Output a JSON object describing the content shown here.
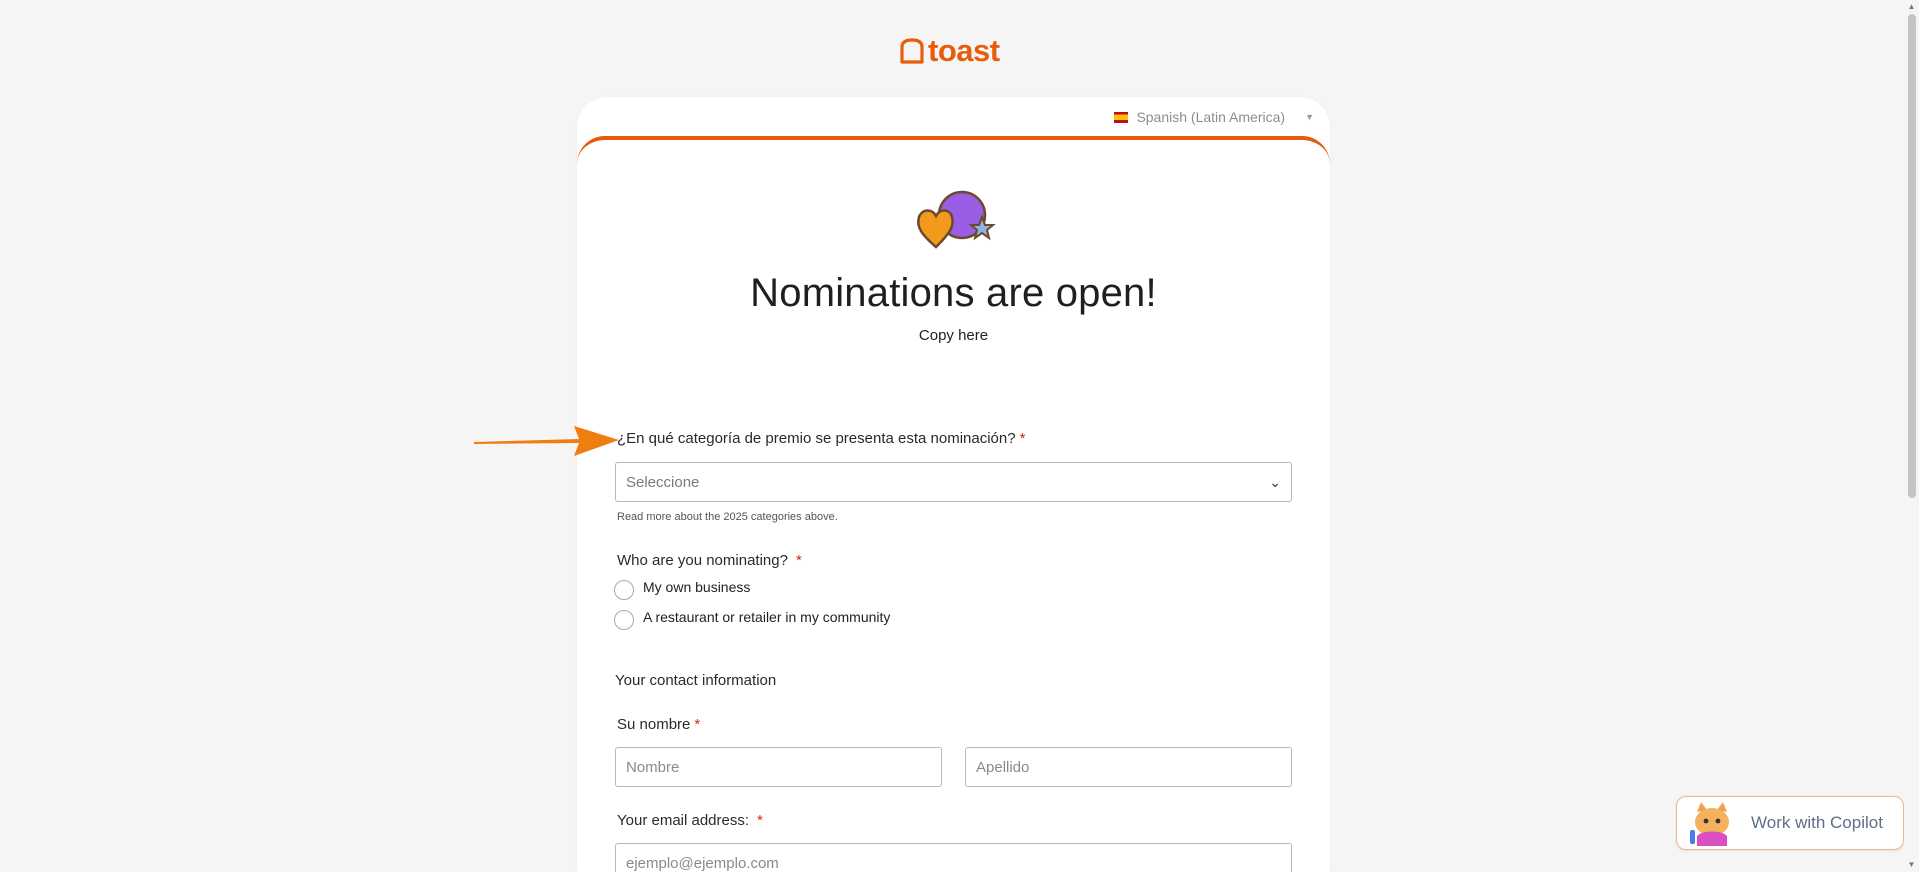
{
  "brand": {
    "name": "toast",
    "color": "#e85d0c"
  },
  "language": {
    "selected": "Spanish (Latin America)",
    "flag": "es-flag-icon"
  },
  "hero": {
    "title": "Nominations are open!",
    "subtitle": "Copy here"
  },
  "form": {
    "category": {
      "label": "¿En qué categoría de premio se presenta esta nominación?",
      "required": "*",
      "placeholder": "Seleccione",
      "hint": "Read more about the 2025 categories above."
    },
    "nominee": {
      "label": "Who are you nominating?",
      "required": "*",
      "options": [
        "My own business",
        "A restaurant or retailer in my community"
      ]
    },
    "contact_section": "Your contact information",
    "name": {
      "label": "Su nombre",
      "required": "*",
      "first_placeholder": "Nombre",
      "last_placeholder": "Apellido"
    },
    "email": {
      "label": "Your email address:",
      "required": "*",
      "placeholder": "ejemplo@ejemplo.com"
    }
  },
  "copilot": {
    "label": "Work with Copilot"
  },
  "accent_colors": {
    "orange": "#e8590c",
    "required_red": "#d0271d"
  }
}
